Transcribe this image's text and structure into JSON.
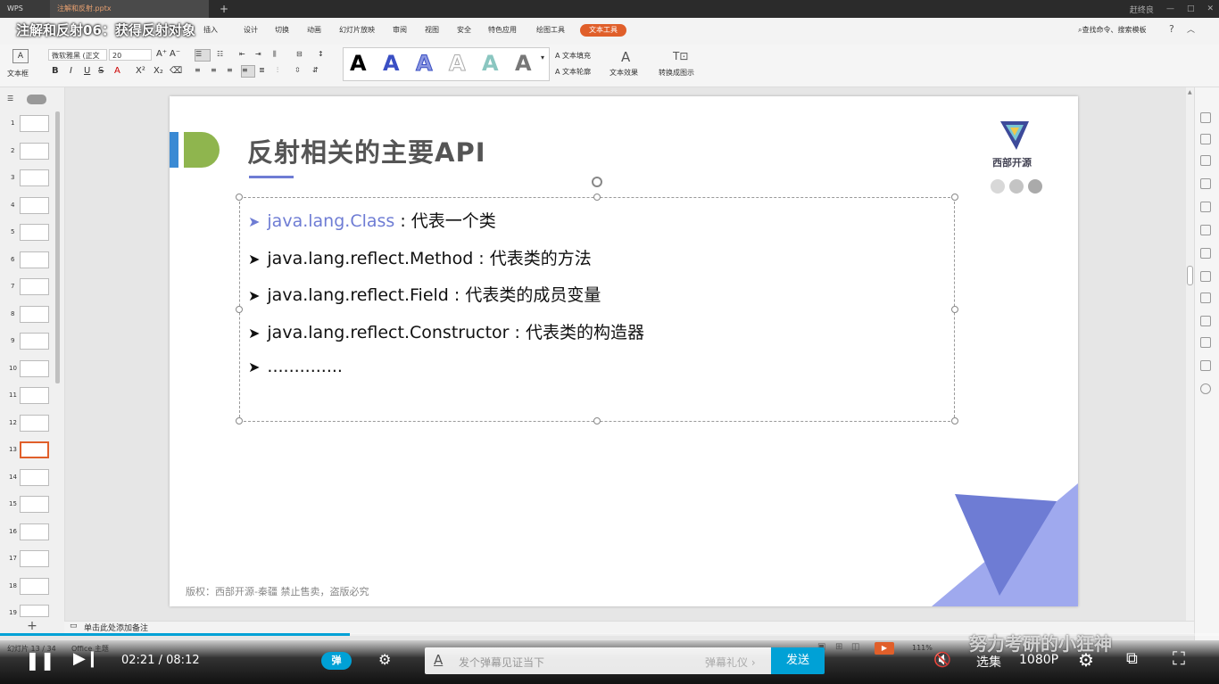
{
  "titlebar": {
    "app_tab": "WPS",
    "doc_tab": "注解和反射.pptx",
    "new_tab": "+",
    "user": "赶终良"
  },
  "video": {
    "title": "注解和反射06：获得反射对象",
    "time_current": "02:21",
    "time_separator": "/",
    "time_total": "08:12",
    "progress": 0.287,
    "danmu_toggle": "弹",
    "danmu_placeholder": "发个弹幕见证当下",
    "danmu_etiquette": "弹幕礼仪 ›",
    "send": "发送",
    "select_episode": "选集",
    "quality": "1080P",
    "watermark": "努力考研的小狂神"
  },
  "menu": {
    "items": [
      "插入",
      "设计",
      "切换",
      "动画",
      "幻灯片放映",
      "审阅",
      "视图",
      "安全",
      "特色应用",
      "绘图工具"
    ],
    "active": "文本工具",
    "search": "查找命令、搜索模板"
  },
  "ribbon": {
    "textbox_label": "文本框",
    "font_name": "微软雅黑 (正文",
    "font_size": "20",
    "text_fill": "文本填充",
    "text_outline": "文本轮廓",
    "text_effect": "文本效果",
    "convert_smartart": "转换成图示",
    "style_glyph": "A"
  },
  "slides": {
    "numbers": [
      "1",
      "2",
      "3",
      "4",
      "5",
      "6",
      "7",
      "8",
      "9",
      "10",
      "11",
      "12",
      "13",
      "14",
      "15",
      "16",
      "17",
      "18",
      "19"
    ],
    "active": 13
  },
  "slide": {
    "title": "反射相关的主要API",
    "logo_text": "西部开源",
    "bullets": [
      {
        "kw": "java.lang.Class",
        "rest": " : 代表一个类"
      },
      {
        "kw": "",
        "rest": "java.lang.reflect.Method : 代表类的方法"
      },
      {
        "kw": "",
        "rest": "java.lang.reflect.Field : 代表类的成员变量"
      },
      {
        "kw": "",
        "rest": "java.lang.reflect.Constructor : 代表类的构造器"
      },
      {
        "kw": "",
        "rest": ".............."
      }
    ],
    "copyright": "版权：西部开源-秦疆     禁止售卖，盗版必究"
  },
  "notes": {
    "placeholder": "单击此处添加备注"
  },
  "status": {
    "slide_count": "幻灯片 13 / 34",
    "theme": "Office 主题",
    "zoom": "111%"
  },
  "colors": {
    "accent": "#6e7cd4",
    "brand_orange": "#e05f2a",
    "bilibili_blue": "#00a1d6",
    "green_shape": "#8fb54e"
  }
}
